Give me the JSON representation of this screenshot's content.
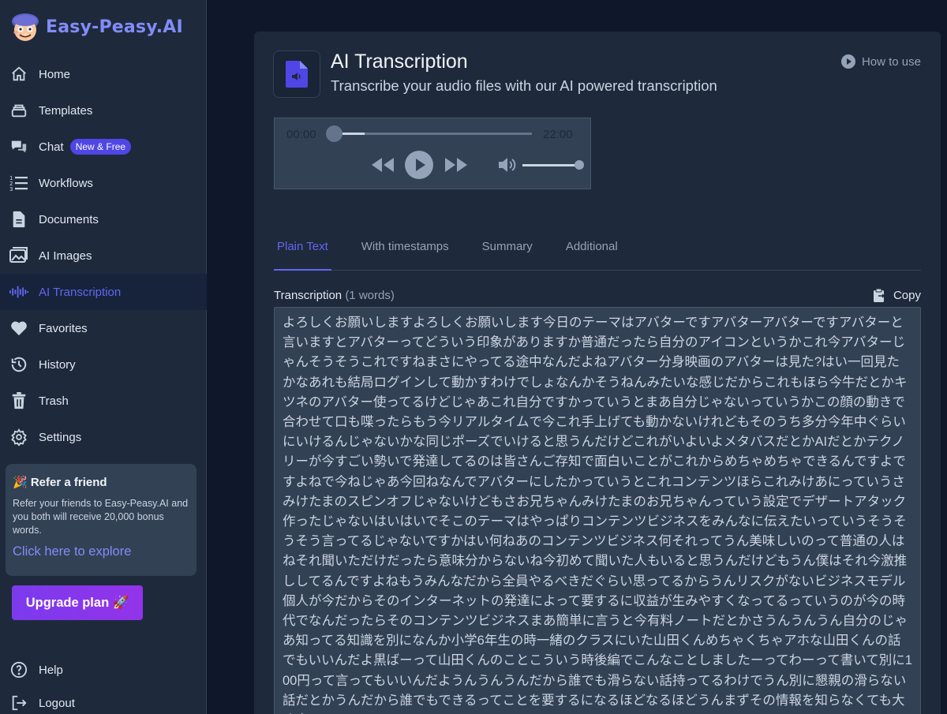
{
  "brand": {
    "name": "Easy-Peasy.AI"
  },
  "sidebar": {
    "items": [
      {
        "label": "Home",
        "icon": "home-icon"
      },
      {
        "label": "Templates",
        "icon": "templates-icon"
      },
      {
        "label": "Chat",
        "icon": "chat-icon",
        "badge": "New & Free"
      },
      {
        "label": "Workflows",
        "icon": "workflows-icon"
      },
      {
        "label": "Documents",
        "icon": "document-icon"
      },
      {
        "label": "AI Images",
        "icon": "images-icon"
      },
      {
        "label": "AI Transcription",
        "icon": "waveform-icon",
        "active": true
      },
      {
        "label": "Favorites",
        "icon": "heart-icon"
      },
      {
        "label": "History",
        "icon": "history-icon"
      },
      {
        "label": "Trash",
        "icon": "trash-icon"
      },
      {
        "label": "Settings",
        "icon": "gear-icon"
      }
    ],
    "refer": {
      "title": "🎉 Refer a friend",
      "text": "Refer your friends to Easy-Peasy.AI and you both will receive 20,000 bonus words.",
      "link": "Click here to explore"
    },
    "upgrade_label": "Upgrade plan 🚀",
    "bottom": [
      {
        "label": "Help",
        "icon": "help-icon"
      },
      {
        "label": "Logout",
        "icon": "logout-icon"
      }
    ]
  },
  "main": {
    "title": "AI Transcription",
    "subtitle": "Transcribe your audio files with our AI powered transcription",
    "how_to_use": "How to use",
    "player": {
      "current_time": "00:00",
      "duration": "22:00",
      "progress": 0.16,
      "volume": 0.95
    },
    "tabs": [
      "Plain Text",
      "With timestamps",
      "Summary",
      "Additional"
    ],
    "active_tab": "Plain Text",
    "transcription_label": "Transcription",
    "word_count": "(1 words)",
    "copy_label": "Copy",
    "transcription_text": "よろしくお願いしますよろしくお願いします今日のテーマはアバターですアバターアバターですアバターと言いますとアバターってどういう印象がありますか普通だったら自分のアイコンというかこれ今アバターじゃんそうそうこれですねまさにやってる途中なんだよねアバター分身映画のアバターは見た?はい一回見たかなあれも結局ログインして動かすわけでしょなんかそうねんみたいな感じだからこれもほら今牛だとかキツネのアバター使ってるけどじゃあこれ自分ですかっていうとまあ自分じゃないっていうかこの顔の動きで合わせて口も喋ったらもう今リアルタイムで今これ手上げても動かないけれどもそのうち多分今年中ぐらいにいけるんじゃないかな同じポーズでいけると思うんだけどこれがいよいよメタバスだとかAIだとかテクノリーが今すごい勢いで発達してるのは皆さんご存知で面白いことがこれからめちゃめちゃできるんですよですよねで今ねじゃあ今回ねなんでアバターにしたかっていうとこれコンテンツほらこれみけあにっていうさみけたまのスピンオフじゃないけどもさお兄ちゃんみけたまのお兄ちゃんっていう設定でデザートアタック作ったじゃないはいはいでそこのテーマはやっぱりコンテンツビジネスをみんなに伝えたいっていうそうそうそう言ってるじゃないですかはい何ねあのコンテンツビジネス何それってうん美味しいのって普通の人はねそれ聞いただけだったら意味分からないね今初めて聞いた人もいると思うんだけどもうん僕はそれ今激推ししてるんですよねもうみんなだから全員やるべきだぐらい思ってるからうんリスクがないビジネスモデル個人が今だからそのインターネットの発達によって要するに収益が生みやすくなってるっていうのが今の時代でなんだったらそのコンテンツビジネスまあ簡単に言うと今有料ノートだとかさうんうんうん自分のじゃあ知ってる知識を別になんか小学6年生の時一緒のクラスにいた山田くんめちゃくちゃアホな山田くんの話でもいいんだよ黒ばーって山田くんのことこういう時後編でこんなことしましたーってわーって書いて別に100円って言ってもいいんだようんうんうんだから誰でも滑らない話持ってるわけでうん別に懇親の滑らない話だとかうんだから誰でもできるってことを要するになるほどなるほどうんまずその情報を知らなくても大丈夫だしうんうん"
  }
}
